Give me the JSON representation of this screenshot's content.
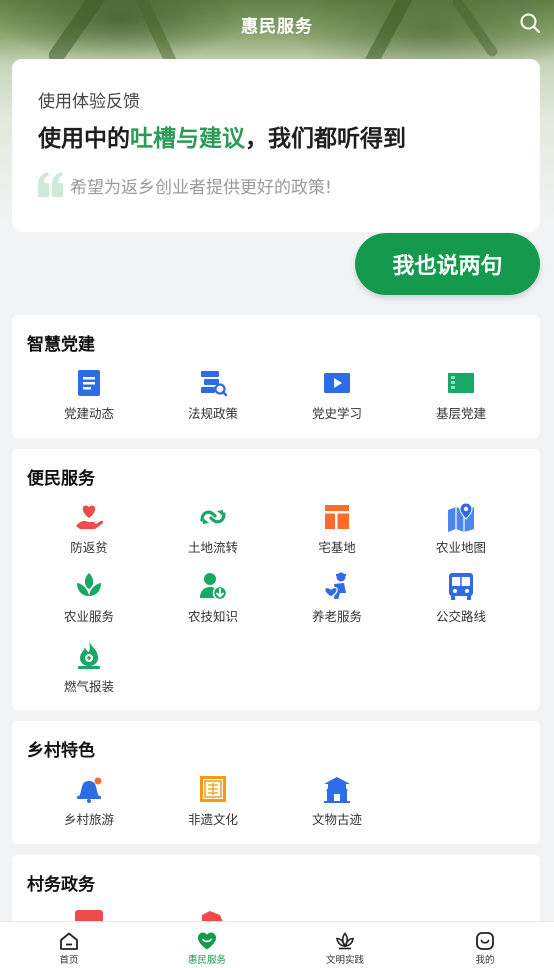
{
  "header": {
    "title": "惠民服务",
    "search_icon": "search-icon"
  },
  "feedback": {
    "subtitle": "使用体验反馈",
    "headline_pre": "使用中的",
    "headline_highlight": "吐槽与建议",
    "headline_post": "，我们都听得到",
    "hint": "希望为返乡创业者提供更好的政策!",
    "button": "我也说两句",
    "accent": "#159a4d"
  },
  "sections": [
    {
      "title": "智慧党建",
      "items": [
        {
          "label": "党建动态",
          "icon": "document-icon"
        },
        {
          "label": "法规政策",
          "icon": "policy-search-icon"
        },
        {
          "label": "党史学习",
          "icon": "video-play-icon"
        },
        {
          "label": "基层党建",
          "icon": "flag-icon"
        }
      ]
    },
    {
      "title": "便民服务",
      "items": [
        {
          "label": "防返贫",
          "icon": "heart-hand-icon"
        },
        {
          "label": "土地流转",
          "icon": "recycle-icon"
        },
        {
          "label": "宅基地",
          "icon": "house-plot-icon"
        },
        {
          "label": "农业地图",
          "icon": "map-pin-icon"
        },
        {
          "label": "农业服务",
          "icon": "sprout-icon"
        },
        {
          "label": "农技知识",
          "icon": "farmer-download-icon"
        },
        {
          "label": "养老服务",
          "icon": "elderly-care-icon"
        },
        {
          "label": "公交路线",
          "icon": "bus-icon"
        },
        {
          "label": "燃气报装",
          "icon": "gas-flame-icon"
        }
      ]
    },
    {
      "title": "乡村特色",
      "items": [
        {
          "label": "乡村旅游",
          "icon": "bell-tour-icon"
        },
        {
          "label": "非遗文化",
          "icon": "heritage-seal-icon"
        },
        {
          "label": "文物古迹",
          "icon": "pavilion-icon"
        }
      ]
    },
    {
      "title": "村务政务",
      "items": []
    }
  ],
  "tabbar": [
    {
      "label": "首页",
      "icon": "home-icon"
    },
    {
      "label": "惠民服务",
      "icon": "heart-service-icon",
      "active": true
    },
    {
      "label": "文明实践",
      "icon": "lotus-icon"
    },
    {
      "label": "我的",
      "icon": "smile-profile-icon"
    }
  ],
  "colors": {
    "blue": "#2e6be6",
    "green": "#17a865",
    "red": "#ee4c4c",
    "orange": "#ff6b2c",
    "amber": "#f39c12"
  }
}
